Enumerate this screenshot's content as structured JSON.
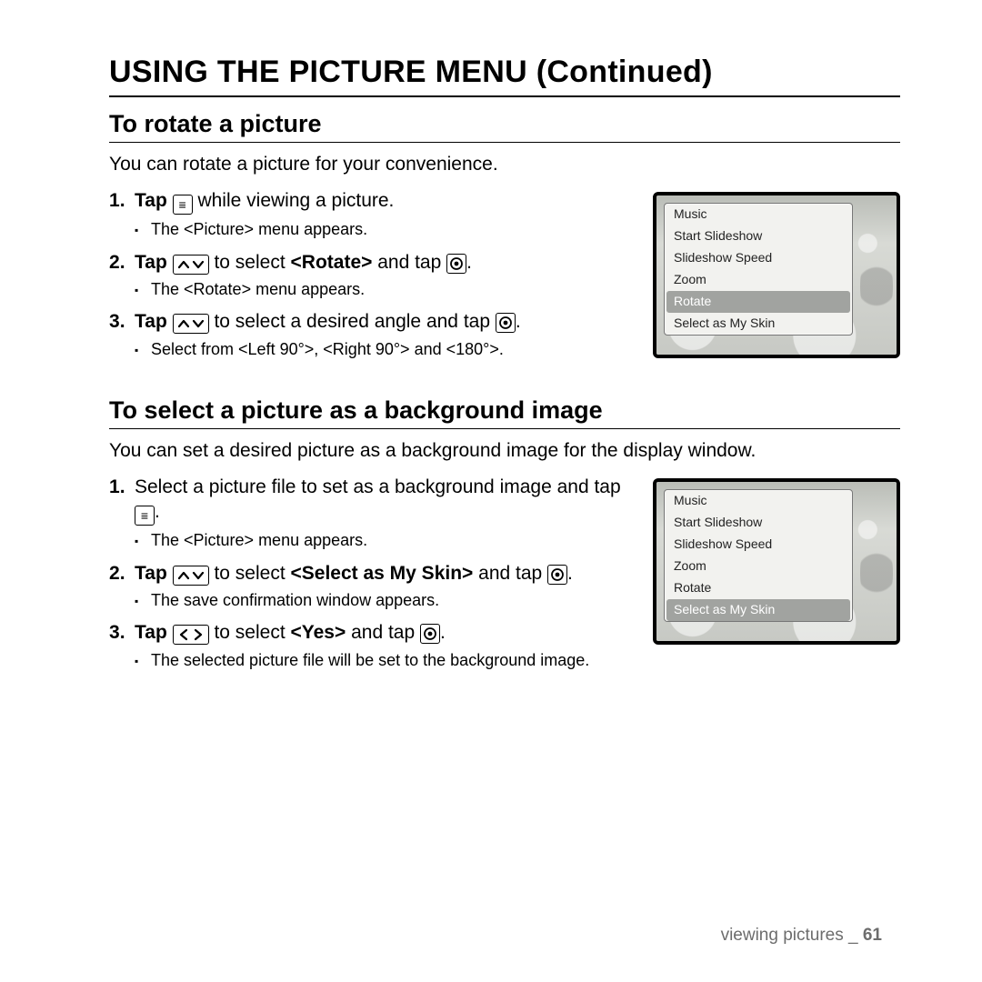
{
  "page_title": "USING THE PICTURE MENU (Continued)",
  "section1": {
    "title": "To rotate a picture",
    "intro": "You can rotate a picture for your convenience.",
    "step1_a": "Tap ",
    "step1_b": " while viewing a picture.",
    "step1_sub": "The <Picture> menu appears.",
    "step2_a": "Tap ",
    "step2_b": " to select ",
    "step2_bold": "<Rotate>",
    "step2_c": " and tap ",
    "step2_d": ".",
    "step2_sub": "The <Rotate> menu appears.",
    "step3_a": "Tap ",
    "step3_b": " to select a desired angle and tap ",
    "step3_c": ".",
    "step3_sub": "Select from <Left 90°>, <Right 90°> and <180°>.",
    "menu_items": [
      "Music",
      "Start Slideshow",
      "Slideshow Speed",
      "Zoom",
      "Rotate",
      "Select as My Skin"
    ],
    "menu_selected": "Rotate"
  },
  "section2": {
    "title": "To select a picture as a background image",
    "intro": "You can set a desired picture as a background image for the display window.",
    "step1_a": "Select a picture file to set as a background image and tap ",
    "step1_b": ".",
    "step1_sub": "The <Picture> menu appears.",
    "step2_a": "Tap ",
    "step2_b": " to select ",
    "step2_bold": "<Select as My Skin>",
    "step2_c": " and tap ",
    "step2_d": ".",
    "step2_sub": "The save confirmation window appears.",
    "step3_a": "Tap ",
    "step3_b": " to select ",
    "step3_bold": "<Yes>",
    "step3_c": " and tap ",
    "step3_d": ".",
    "step3_sub": "The selected picture file will be set to the background image.",
    "menu_items": [
      "Music",
      "Start Slideshow",
      "Slideshow Speed",
      "Zoom",
      "Rotate",
      "Select as My Skin"
    ],
    "menu_selected": "Select as My Skin"
  },
  "footer": {
    "section": "viewing pictures",
    "sep": " _ ",
    "page": "61"
  }
}
